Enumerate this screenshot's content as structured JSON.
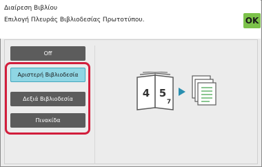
{
  "header": {
    "title": "Διαίρεση Βιβλίου",
    "subtitle": "Επιλογή Πλευράς Βιβλιοδεσίας Πρωτοτύπου.",
    "ok_label": "OK"
  },
  "options": [
    {
      "label": "Off",
      "selected": false
    },
    {
      "label": "Αριστερή Βιβλιοδεσία",
      "selected": true
    },
    {
      "label": "Δεξιά Βιβλιοδεσία",
      "selected": false
    },
    {
      "label": "Πινακίδα",
      "selected": false
    }
  ],
  "illustration": {
    "page_numbers": [
      "4",
      "5",
      "7"
    ],
    "icons": [
      "open-book-icon",
      "arrow-right-icon",
      "document-stack-icon"
    ]
  },
  "colors": {
    "ok_button": "#7cc24a",
    "selected_option": "#8fd6e4",
    "option": "#5c5c5c",
    "highlight_border": "#d21e3c",
    "arrow": "#2a8fb0"
  }
}
